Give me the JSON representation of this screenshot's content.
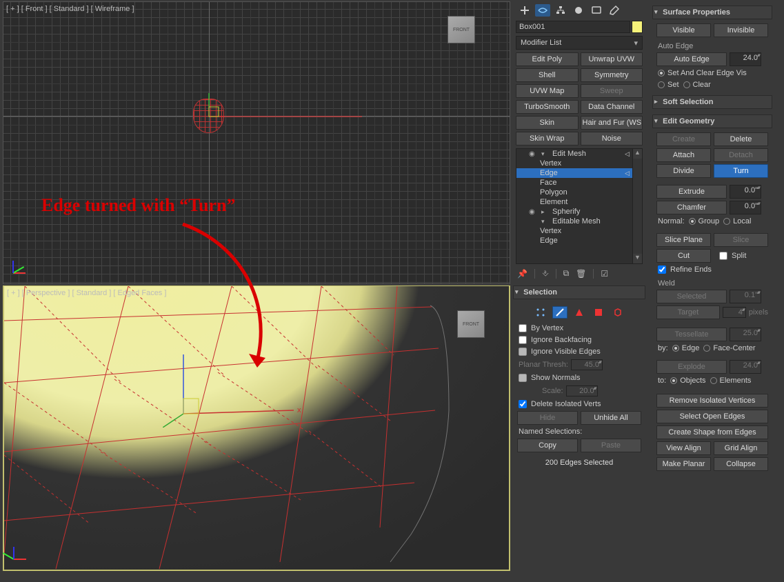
{
  "viewports": {
    "top": {
      "label": "[ + ] [ Front ] [ Standard ] [ Wireframe ]",
      "cube": "FRONT"
    },
    "bottom": {
      "label": "[ + ] [ Perspective ] [ Standard ] [ Edged Faces ]",
      "cube": "FRONT"
    }
  },
  "annotation": "Edge turned with “Turn”",
  "object_name": "Box001",
  "modifier_list_label": "Modifier List",
  "mod_buttons": {
    "edit_poly": "Edit Poly",
    "unwrap": "Unwrap UVW",
    "shell": "Shell",
    "symmetry": "Symmetry",
    "uvw_map": "UVW Map",
    "sweep": "Sweep",
    "turbo": "TurboSmooth",
    "datachan": "Data Channel",
    "skin": "Skin",
    "hairfur": "Hair and Fur (WSM)",
    "skinwrap": "Skin Wrap",
    "noise": "Noise"
  },
  "stack": [
    {
      "eye": true,
      "tri": "▾",
      "label": "Edit Mesh",
      "indent": 0,
      "end": "◁"
    },
    {
      "label": "Vertex",
      "indent": 1
    },
    {
      "label": "Edge",
      "indent": 1,
      "sel": true,
      "end": "◁"
    },
    {
      "label": "Face",
      "indent": 1
    },
    {
      "label": "Polygon",
      "indent": 1
    },
    {
      "label": "Element",
      "indent": 1
    },
    {
      "eye": true,
      "tri": "▸",
      "label": "Spherify",
      "indent": 0
    },
    {
      "tri": "▾",
      "label": "Editable Mesh",
      "indent": 0
    },
    {
      "label": "Vertex",
      "indent": 1
    },
    {
      "label": "Edge",
      "indent": 1
    }
  ],
  "selection": {
    "header": "Selection",
    "by_vertex": "By Vertex",
    "ignore_backfacing": "Ignore Backfacing",
    "ignore_visible_edges": "Ignore Visible Edges",
    "planar_thresh": "Planar Thresh:",
    "planar_val": "45.0",
    "show_normals": "Show Normals",
    "scale_lbl": "Scale:",
    "scale_val": "20.0",
    "delete_iso": "Delete Isolated Verts",
    "hide": "Hide",
    "unhide": "Unhide All",
    "named_sel": "Named Selections:",
    "copy": "Copy",
    "paste": "Paste",
    "status": "200 Edges Selected"
  },
  "surface_props": {
    "header": "Surface Properties",
    "visible": "Visible",
    "invisible": "Invisible",
    "auto_edge_lbl": "Auto Edge",
    "auto_edge_btn": "Auto Edge",
    "auto_edge_val": "24.0",
    "set_clear": "Set And Clear Edge Vis",
    "set": "Set",
    "clear": "Clear"
  },
  "soft_sel": {
    "header": "Soft Selection"
  },
  "edit_geom": {
    "header": "Edit Geometry",
    "create": "Create",
    "delete": "Delete",
    "attach": "Attach",
    "detach": "Detach",
    "divide": "Divide",
    "turn": "Turn",
    "extrude": "Extrude",
    "extrude_val": "0.0\"",
    "chamfer": "Chamfer",
    "chamfer_val": "0.0\"",
    "normal": "Normal:",
    "group": "Group",
    "local": "Local",
    "slice_plane": "Slice Plane",
    "slice": "Slice",
    "cut": "Cut",
    "split": "Split",
    "refine_ends": "Refine Ends",
    "weld": "Weld",
    "selected": "Selected",
    "selected_val": "0.1\"",
    "target": "Target",
    "target_val": "4",
    "pixels": "pixels",
    "tessellate": "Tessellate",
    "tess_val": "25.0",
    "by": "by:",
    "edge": "Edge",
    "facecenter": "Face-Center",
    "explode": "Explode",
    "explode_val": "24.0",
    "to": "to:",
    "objects": "Objects",
    "elements": "Elements",
    "remove_iso": "Remove Isolated Vertices",
    "select_open": "Select Open Edges",
    "create_shape": "Create Shape from Edges",
    "view_align": "View Align",
    "grid_align": "Grid Align",
    "make_planar": "Make Planar",
    "collapse": "Collapse"
  }
}
